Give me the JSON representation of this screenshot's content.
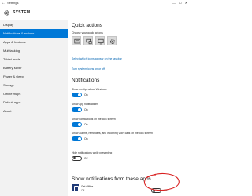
{
  "window": {
    "title": "Settings",
    "back_glyph": "←",
    "controls": [
      "—",
      "☐",
      "✕"
    ]
  },
  "header": {
    "icon": "gear-icon",
    "title": "SYSTEM"
  },
  "sidebar": {
    "items": [
      {
        "label": "Display",
        "active": false
      },
      {
        "label": "Notifications & actions",
        "active": true
      },
      {
        "label": "Apps & features",
        "active": false
      },
      {
        "label": "Multitasking",
        "active": false
      },
      {
        "label": "Tablet mode",
        "active": false
      },
      {
        "label": "Battery saver",
        "active": false
      },
      {
        "label": "Power & sleep",
        "active": false
      },
      {
        "label": "Storage",
        "active": false
      },
      {
        "label": "Offline maps",
        "active": false
      },
      {
        "label": "Default apps",
        "active": false
      },
      {
        "label": "About",
        "active": false
      }
    ]
  },
  "quick_actions": {
    "title": "Quick actions",
    "subtitle": "Choose your quick actions",
    "tiles": [
      "action-center-icon",
      "connect-icon",
      "display-icon",
      "settings-icon"
    ],
    "link_taskbar": "Select which icons appear on the taskbar",
    "link_system": "Turn system icons on or off"
  },
  "notifications": {
    "title": "Notifications",
    "settings": [
      {
        "label": "Show me tips about Windows",
        "state": "On"
      },
      {
        "label": "Show app notifications",
        "state": "On"
      },
      {
        "label": "Show notifications on the lock screen",
        "state": "On"
      },
      {
        "label": "Show alarms, reminders, and incoming VoIP calls on the lock screen",
        "state": "On"
      },
      {
        "label": "Hide notifications while presenting",
        "state": "Off"
      }
    ]
  },
  "apps": {
    "title": "Show notifications from these apps",
    "items": [
      {
        "name": "Get Office",
        "sub": "Off",
        "state": "Off",
        "icon": "office-icon"
      }
    ]
  },
  "annotation": {
    "color": "#d92020"
  },
  "colors": {
    "accent": "#0078d7",
    "link": "#0063b1"
  }
}
